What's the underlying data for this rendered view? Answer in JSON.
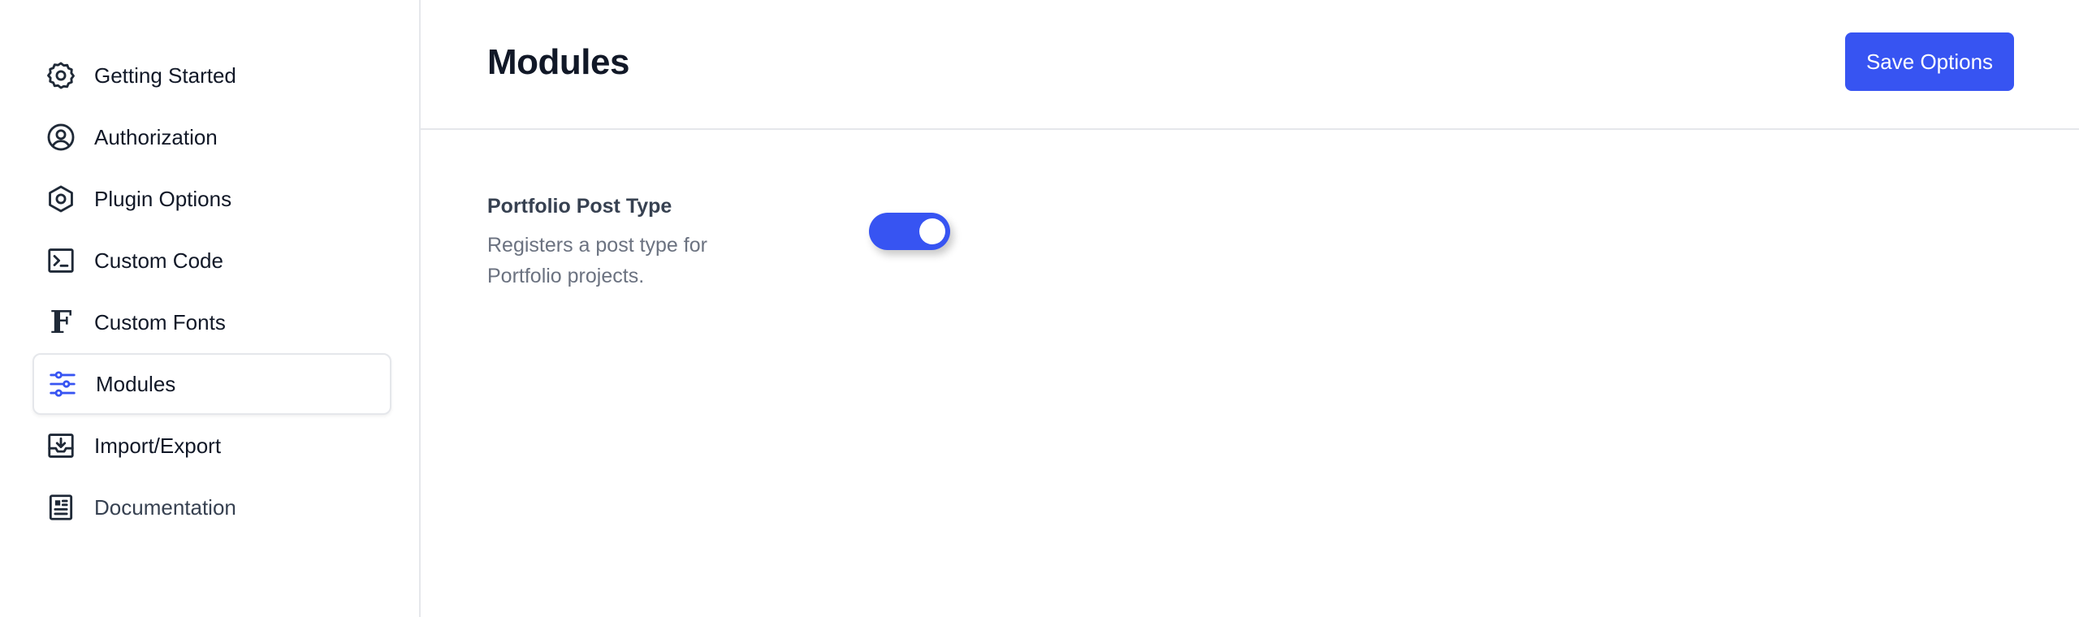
{
  "sidebar": {
    "items": [
      {
        "label": "Getting Started",
        "icon": "gear-icon",
        "active": false
      },
      {
        "label": "Authorization",
        "icon": "user-circle-icon",
        "active": false
      },
      {
        "label": "Plugin Options",
        "icon": "hexagon-icon",
        "active": false
      },
      {
        "label": "Custom Code",
        "icon": "terminal-icon",
        "active": false
      },
      {
        "label": "Custom Fonts",
        "icon": "letter-f-icon",
        "glyph": "F",
        "active": false
      },
      {
        "label": "Modules",
        "icon": "sliders-icon",
        "active": true
      },
      {
        "label": "Import/Export",
        "icon": "download-tray-icon",
        "active": false
      },
      {
        "label": "Documentation",
        "icon": "document-icon",
        "active": false
      }
    ]
  },
  "header": {
    "title": "Modules",
    "save_label": "Save Options"
  },
  "modules": [
    {
      "title": "Portfolio Post Type",
      "description": "Registers a post type for Portfolio projects.",
      "enabled": true
    }
  ],
  "colors": {
    "accent": "#3754f2",
    "text": "#111827",
    "muted": "#6b7280",
    "border": "#e5e7eb"
  }
}
